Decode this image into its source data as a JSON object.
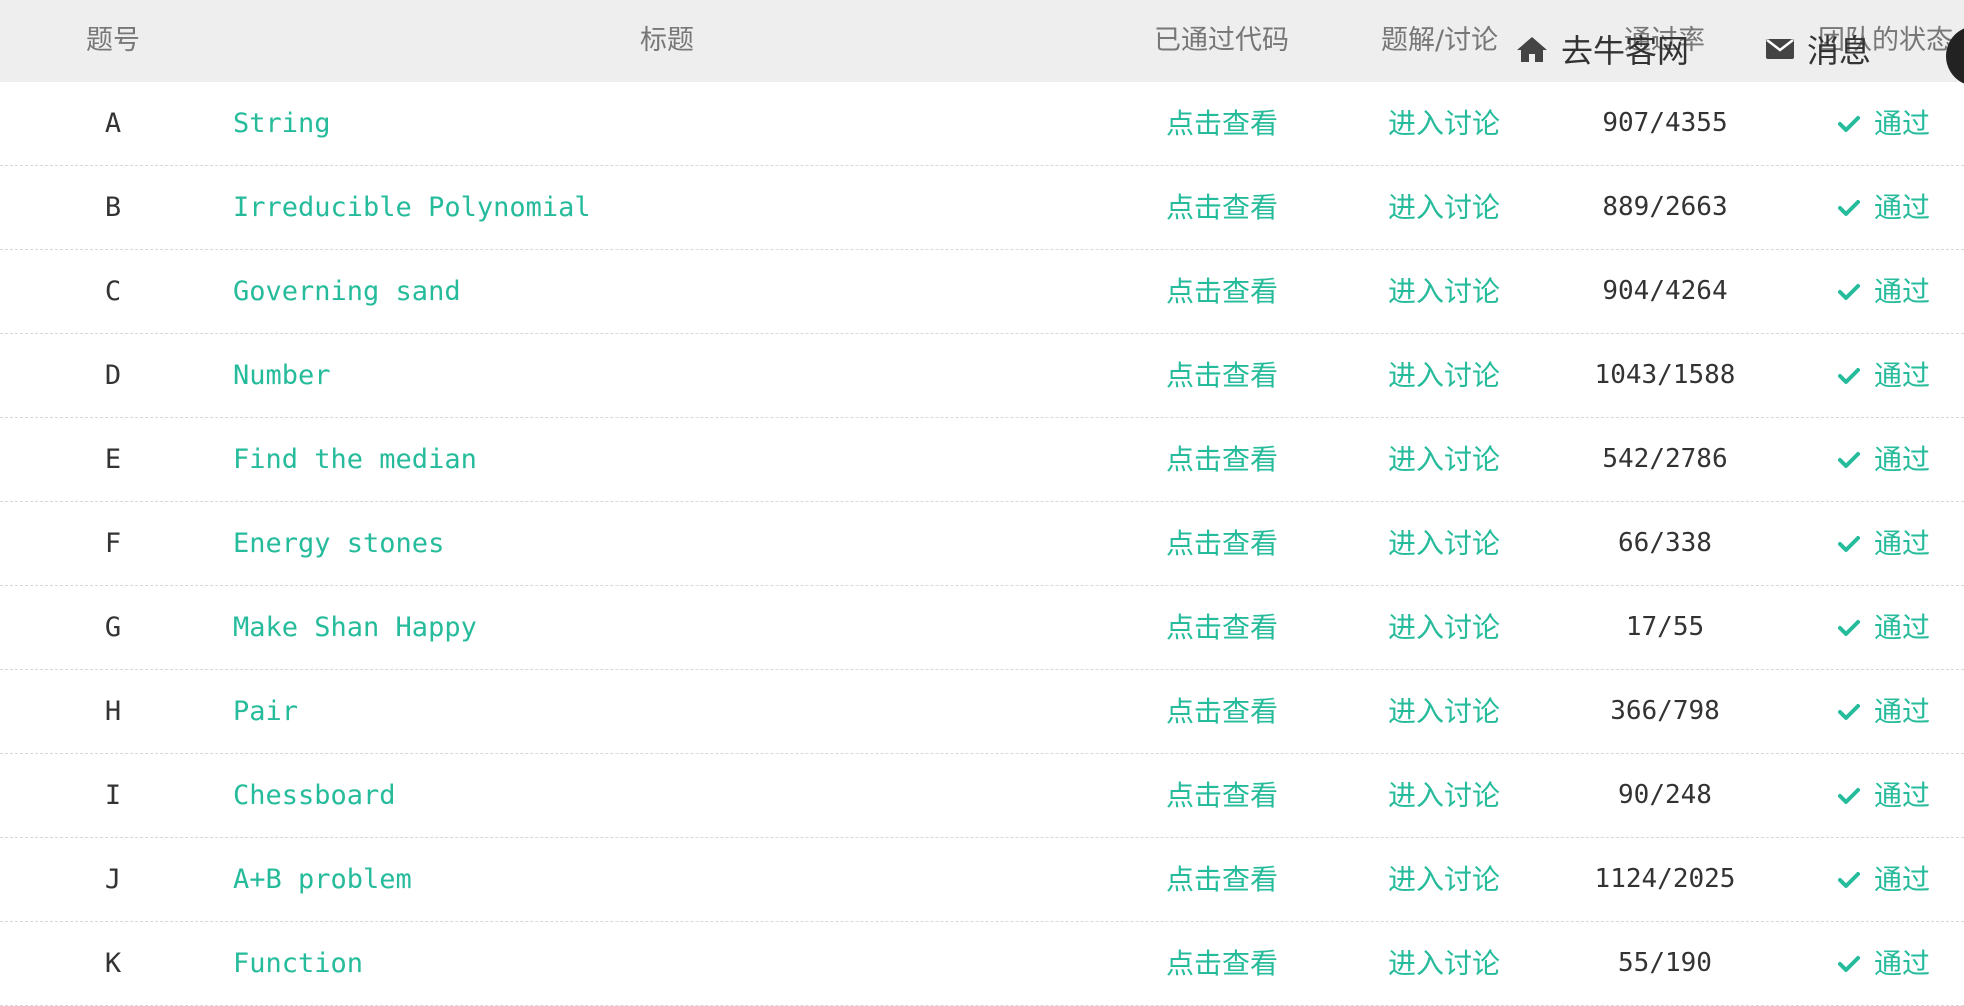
{
  "colors": {
    "accent": "#25bb9b",
    "header_bg": "#eeeeee",
    "header_text": "#777777",
    "text": "#333333",
    "row_divider": "#d8d8d8"
  },
  "header": {
    "num": "题号",
    "title": "标题",
    "passed_code": "已通过代码",
    "discussion": "题解/讨论",
    "pass_rate": "通过率",
    "team_status": "团队的状态"
  },
  "nav": {
    "home_icon": "home-icon",
    "home_label": "去牛客网",
    "message_icon": "envelope-icon",
    "message_label": "消息"
  },
  "problems": [
    {
      "id": "A",
      "title": "String",
      "code_link": "点击查看",
      "discuss_link": "进入讨论",
      "rate": "907/4355",
      "status": "通过"
    },
    {
      "id": "B",
      "title": "Irreducible Polynomial",
      "code_link": "点击查看",
      "discuss_link": "进入讨论",
      "rate": "889/2663",
      "status": "通过"
    },
    {
      "id": "C",
      "title": "Governing sand",
      "code_link": "点击查看",
      "discuss_link": "进入讨论",
      "rate": "904/4264",
      "status": "通过"
    },
    {
      "id": "D",
      "title": "Number",
      "code_link": "点击查看",
      "discuss_link": "进入讨论",
      "rate": "1043/1588",
      "status": "通过"
    },
    {
      "id": "E",
      "title": "Find the median",
      "code_link": "点击查看",
      "discuss_link": "进入讨论",
      "rate": "542/2786",
      "status": "通过"
    },
    {
      "id": "F",
      "title": "Energy stones",
      "code_link": "点击查看",
      "discuss_link": "进入讨论",
      "rate": "66/338",
      "status": "通过"
    },
    {
      "id": "G",
      "title": "Make Shan Happy",
      "code_link": "点击查看",
      "discuss_link": "进入讨论",
      "rate": "17/55",
      "status": "通过"
    },
    {
      "id": "H",
      "title": "Pair",
      "code_link": "点击查看",
      "discuss_link": "进入讨论",
      "rate": "366/798",
      "status": "通过"
    },
    {
      "id": "I",
      "title": "Chessboard",
      "code_link": "点击查看",
      "discuss_link": "进入讨论",
      "rate": "90/248",
      "status": "通过"
    },
    {
      "id": "J",
      "title": "A+B problem",
      "code_link": "点击查看",
      "discuss_link": "进入讨论",
      "rate": "1124/2025",
      "status": "通过"
    },
    {
      "id": "K",
      "title": "Function",
      "code_link": "点击查看",
      "discuss_link": "进入讨论",
      "rate": "55/190",
      "status": "通过"
    }
  ]
}
